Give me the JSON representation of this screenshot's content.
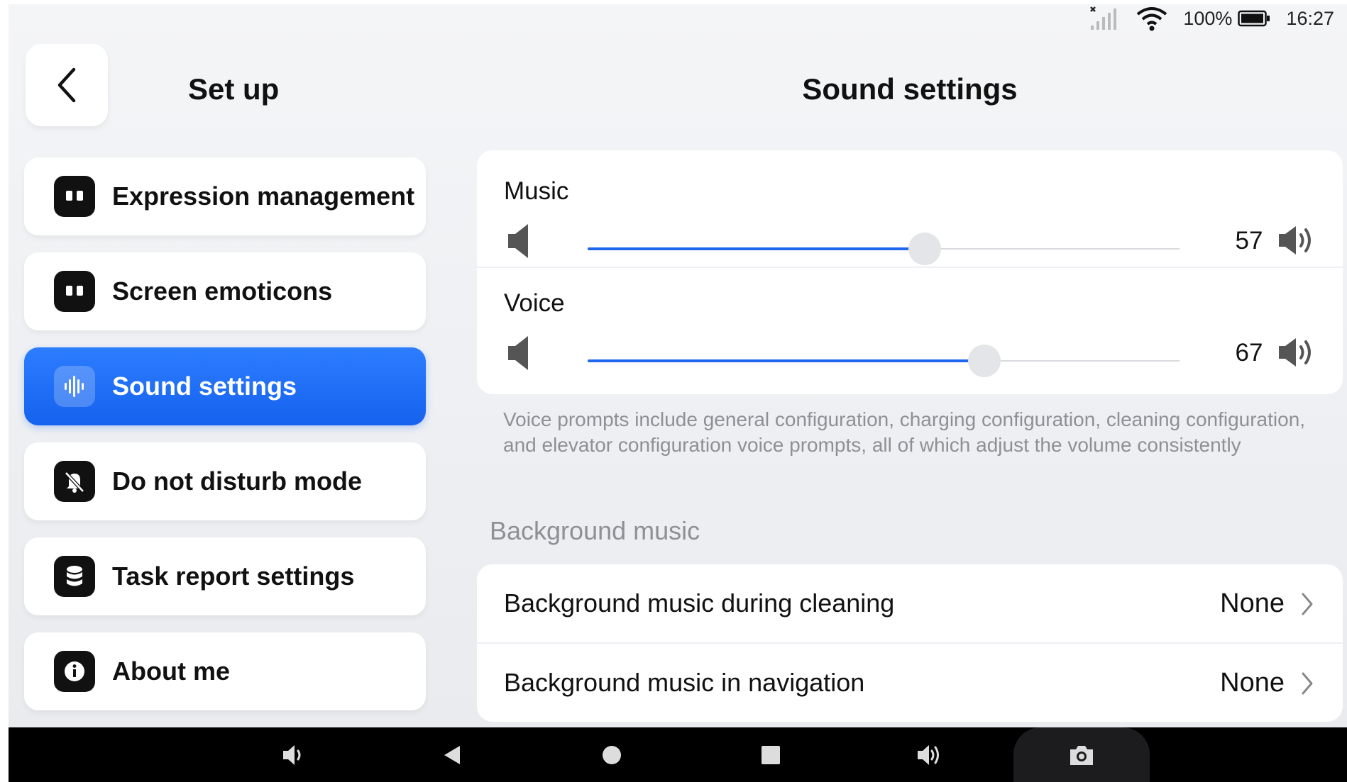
{
  "status_bar": {
    "battery": "100%",
    "time": "16:27"
  },
  "left": {
    "title": "Set up",
    "menu": [
      {
        "label": "Expression management",
        "icon": "face-icon",
        "active": false
      },
      {
        "label": "Screen emoticons",
        "icon": "face-icon",
        "active": false
      },
      {
        "label": "Sound settings",
        "icon": "sound-wave-icon",
        "active": true
      },
      {
        "label": "Do not disturb mode",
        "icon": "bell-off-icon",
        "active": false
      },
      {
        "label": "Task report settings",
        "icon": "database-icon",
        "active": false
      },
      {
        "label": "About me",
        "icon": "info-icon",
        "active": false
      }
    ]
  },
  "right": {
    "title": "Sound settings",
    "music": {
      "label": "Music",
      "value": "57",
      "level": 57
    },
    "voice": {
      "label": "Voice",
      "value": "67",
      "level": 67
    },
    "hint": "Voice prompts include general configuration, charging configuration, cleaning configuration, and elevator configuration voice prompts, all of which adjust the volume consistently",
    "section_title": "Background music",
    "bg_rows": [
      {
        "label": "Background music during cleaning",
        "value": "None"
      },
      {
        "label": "Background music in navigation",
        "value": "None"
      }
    ]
  },
  "colors": {
    "accent": "#1e66f0",
    "active_menu": "#1562ee",
    "muted_text": "#8d9096"
  }
}
